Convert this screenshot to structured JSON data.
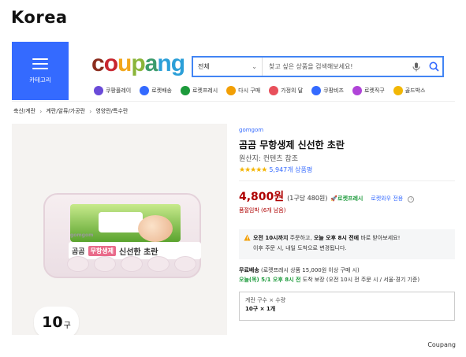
{
  "page": {
    "heading": "Korea",
    "source": "Coupang"
  },
  "header": {
    "category_label": "카테고리",
    "logo_letters": [
      {
        "ch": "c",
        "color": "#8b2d1e"
      },
      {
        "ch": "o",
        "color": "#c8262f"
      },
      {
        "ch": "u",
        "color": "#f2a71b"
      },
      {
        "ch": "p",
        "color": "#8ab539"
      },
      {
        "ch": "a",
        "color": "#3b9b6c"
      },
      {
        "ch": "n",
        "color": "#2b9fd8"
      },
      {
        "ch": "g",
        "color": "#2b9fd8"
      }
    ],
    "search": {
      "category": "전체",
      "placeholder": "찾고 싶은 상품을 검색해보세요!"
    },
    "shortcuts": [
      {
        "label": "쿠팡플레이",
        "color": "#6a4bd8"
      },
      {
        "label": "로켓배송",
        "color": "#346aff"
      },
      {
        "label": "로켓프레시",
        "color": "#1c9a3b"
      },
      {
        "label": "다시 구매",
        "color": "#f29f05"
      },
      {
        "label": "가정의 달",
        "color": "#e8505b"
      },
      {
        "label": "쿠팡비즈",
        "color": "#346aff"
      },
      {
        "label": "로켓직구",
        "color": "#b044d8"
      },
      {
        "label": "골드박스",
        "color": "#f2b705"
      }
    ]
  },
  "breadcrumb": [
    "축산/계란",
    "계란/알류/가공란",
    "영양란/특수란"
  ],
  "product": {
    "count_badge_num": "10",
    "count_badge_unit": "구",
    "image_text": {
      "brand": "gomgom",
      "name_a": "곰곰",
      "name_b": "무항생제",
      "name_c": "신선한 초란"
    },
    "brand": "gomgom",
    "title": "곰곰 무항생제 신선한 초란",
    "origin": "원산지: 컨텐츠 참조",
    "rating_value": 4.5,
    "stars": "★★★★★",
    "rating_count": "5,947개 상품평",
    "price": "4,800원",
    "unit_price": "(1구당 480원)",
    "rocket_fresh": "로켓프레시",
    "wow_only": "로켓와우 전용",
    "soldout": "품절임박 (6개 남음)"
  },
  "notice": {
    "line1_bold": "오전 10시까지",
    "line1_mid": " 주문하고, ",
    "line1_bold2": "오늘 오후 8시 전에",
    "line1_end": " 바로 받아보세요!",
    "line2": "이후 주문 시, 내일 도착으로 변경됩니다."
  },
  "delivery": {
    "line1_bold": "무료배송",
    "line1_rest": " (로켓프레시 상품 15,000원 이상 구매 시)",
    "line2_green": "오늘(목) 5/1 오후 8시 전",
    "line2_rest": " 도착 보장 (오전 10시 전 주문 시 / 서울·경기 기준)"
  },
  "option": {
    "label": "계란 구수 × 수량",
    "value": "10구 × 1개"
  }
}
